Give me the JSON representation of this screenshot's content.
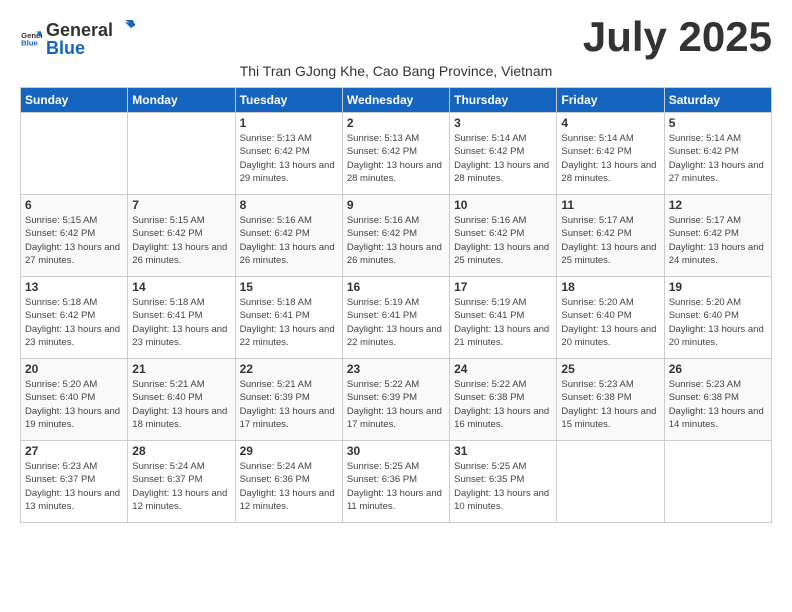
{
  "logo": {
    "general": "General",
    "blue": "Blue"
  },
  "title": "July 2025",
  "subtitle": "Thi Tran GJong Khe, Cao Bang Province, Vietnam",
  "days_of_week": [
    "Sunday",
    "Monday",
    "Tuesday",
    "Wednesday",
    "Thursday",
    "Friday",
    "Saturday"
  ],
  "weeks": [
    [
      {
        "day": "",
        "info": ""
      },
      {
        "day": "",
        "info": ""
      },
      {
        "day": "1",
        "sunrise": "5:13 AM",
        "sunset": "6:42 PM",
        "daylight": "13 hours and 29 minutes."
      },
      {
        "day": "2",
        "sunrise": "5:13 AM",
        "sunset": "6:42 PM",
        "daylight": "13 hours and 28 minutes."
      },
      {
        "day": "3",
        "sunrise": "5:14 AM",
        "sunset": "6:42 PM",
        "daylight": "13 hours and 28 minutes."
      },
      {
        "day": "4",
        "sunrise": "5:14 AM",
        "sunset": "6:42 PM",
        "daylight": "13 hours and 28 minutes."
      },
      {
        "day": "5",
        "sunrise": "5:14 AM",
        "sunset": "6:42 PM",
        "daylight": "13 hours and 27 minutes."
      }
    ],
    [
      {
        "day": "6",
        "sunrise": "5:15 AM",
        "sunset": "6:42 PM",
        "daylight": "13 hours and 27 minutes."
      },
      {
        "day": "7",
        "sunrise": "5:15 AM",
        "sunset": "6:42 PM",
        "daylight": "13 hours and 26 minutes."
      },
      {
        "day": "8",
        "sunrise": "5:16 AM",
        "sunset": "6:42 PM",
        "daylight": "13 hours and 26 minutes."
      },
      {
        "day": "9",
        "sunrise": "5:16 AM",
        "sunset": "6:42 PM",
        "daylight": "13 hours and 26 minutes."
      },
      {
        "day": "10",
        "sunrise": "5:16 AM",
        "sunset": "6:42 PM",
        "daylight": "13 hours and 25 minutes."
      },
      {
        "day": "11",
        "sunrise": "5:17 AM",
        "sunset": "6:42 PM",
        "daylight": "13 hours and 25 minutes."
      },
      {
        "day": "12",
        "sunrise": "5:17 AM",
        "sunset": "6:42 PM",
        "daylight": "13 hours and 24 minutes."
      }
    ],
    [
      {
        "day": "13",
        "sunrise": "5:18 AM",
        "sunset": "6:42 PM",
        "daylight": "13 hours and 23 minutes."
      },
      {
        "day": "14",
        "sunrise": "5:18 AM",
        "sunset": "6:41 PM",
        "daylight": "13 hours and 23 minutes."
      },
      {
        "day": "15",
        "sunrise": "5:18 AM",
        "sunset": "6:41 PM",
        "daylight": "13 hours and 22 minutes."
      },
      {
        "day": "16",
        "sunrise": "5:19 AM",
        "sunset": "6:41 PM",
        "daylight": "13 hours and 22 minutes."
      },
      {
        "day": "17",
        "sunrise": "5:19 AM",
        "sunset": "6:41 PM",
        "daylight": "13 hours and 21 minutes."
      },
      {
        "day": "18",
        "sunrise": "5:20 AM",
        "sunset": "6:40 PM",
        "daylight": "13 hours and 20 minutes."
      },
      {
        "day": "19",
        "sunrise": "5:20 AM",
        "sunset": "6:40 PM",
        "daylight": "13 hours and 20 minutes."
      }
    ],
    [
      {
        "day": "20",
        "sunrise": "5:20 AM",
        "sunset": "6:40 PM",
        "daylight": "13 hours and 19 minutes."
      },
      {
        "day": "21",
        "sunrise": "5:21 AM",
        "sunset": "6:40 PM",
        "daylight": "13 hours and 18 minutes."
      },
      {
        "day": "22",
        "sunrise": "5:21 AM",
        "sunset": "6:39 PM",
        "daylight": "13 hours and 17 minutes."
      },
      {
        "day": "23",
        "sunrise": "5:22 AM",
        "sunset": "6:39 PM",
        "daylight": "13 hours and 17 minutes."
      },
      {
        "day": "24",
        "sunrise": "5:22 AM",
        "sunset": "6:38 PM",
        "daylight": "13 hours and 16 minutes."
      },
      {
        "day": "25",
        "sunrise": "5:23 AM",
        "sunset": "6:38 PM",
        "daylight": "13 hours and 15 minutes."
      },
      {
        "day": "26",
        "sunrise": "5:23 AM",
        "sunset": "6:38 PM",
        "daylight": "13 hours and 14 minutes."
      }
    ],
    [
      {
        "day": "27",
        "sunrise": "5:23 AM",
        "sunset": "6:37 PM",
        "daylight": "13 hours and 13 minutes."
      },
      {
        "day": "28",
        "sunrise": "5:24 AM",
        "sunset": "6:37 PM",
        "daylight": "13 hours and 12 minutes."
      },
      {
        "day": "29",
        "sunrise": "5:24 AM",
        "sunset": "6:36 PM",
        "daylight": "13 hours and 12 minutes."
      },
      {
        "day": "30",
        "sunrise": "5:25 AM",
        "sunset": "6:36 PM",
        "daylight": "13 hours and 11 minutes."
      },
      {
        "day": "31",
        "sunrise": "5:25 AM",
        "sunset": "6:35 PM",
        "daylight": "13 hours and 10 minutes."
      },
      {
        "day": "",
        "info": ""
      },
      {
        "day": "",
        "info": ""
      }
    ]
  ]
}
